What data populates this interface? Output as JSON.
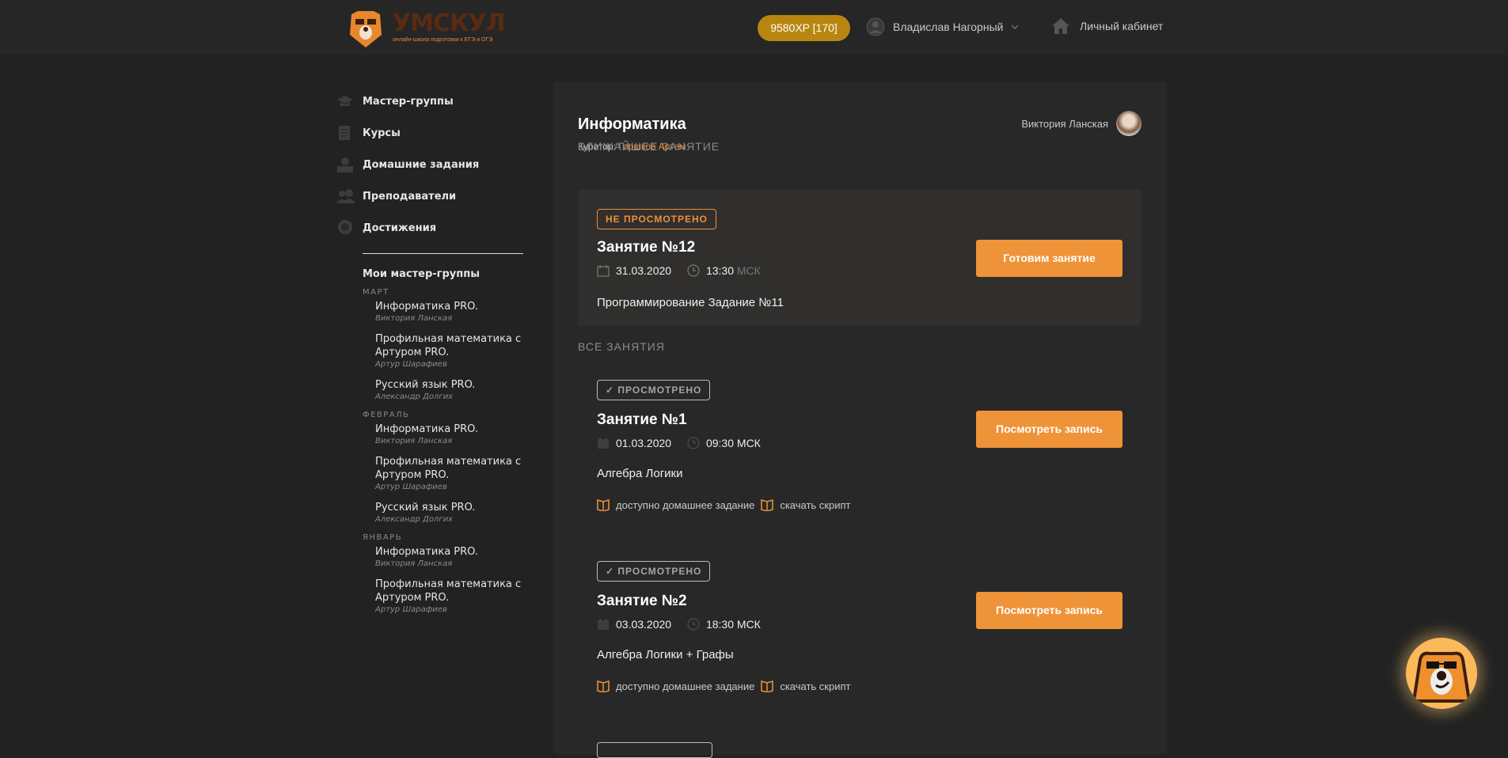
{
  "header": {
    "logo_word": "УМСКУЛ",
    "logo_tagline": "онлайн-школа подготовки к ЕГЭ и ОГЭ",
    "xp": "9580XP [170]",
    "user_name": "Владислав Нагорный",
    "cabinet": "Личный кабинет"
  },
  "sidebar": {
    "nav": [
      {
        "label": "Мастер-группы",
        "icon": "graduation-cap-icon"
      },
      {
        "label": "Курсы",
        "icon": "document-icon"
      },
      {
        "label": "Домашние задания",
        "icon": "books-apple-icon"
      },
      {
        "label": "Преподаватели",
        "icon": "users-icon"
      },
      {
        "label": "Достижения",
        "icon": "medal-icon"
      }
    ],
    "my_groups_title": "Мои мастер-группы",
    "months": [
      {
        "name": "МАРТ",
        "groups": [
          {
            "title": "Информатика PRO.",
            "teacher": "Виктория Ланская"
          },
          {
            "title": "Профильная математика с Артуром PRO.",
            "teacher": "Артур Шарафиев"
          },
          {
            "title": "Русский язык PRO.",
            "teacher": "Александр Долгих"
          }
        ]
      },
      {
        "name": "ФЕВРАЛЬ",
        "groups": [
          {
            "title": "Информатика PRO.",
            "teacher": "Виктория Ланская"
          },
          {
            "title": "Профильная математика с Артуром PRO.",
            "teacher": "Артур Шарафиев"
          },
          {
            "title": "Русский язык PRO.",
            "teacher": "Александр Долгих"
          }
        ]
      },
      {
        "name": "ЯНВАРЬ",
        "groups": [
          {
            "title": "Информатика PRO.",
            "teacher": "Виктория Ланская"
          },
          {
            "title": "Профильная математика с Артуром PRO.",
            "teacher": "Артур Шарафиев"
          }
        ]
      }
    ]
  },
  "main": {
    "title": "Информатика",
    "curator_label": "Куратор:",
    "curator_name": "Горшков Артем",
    "teacher": "Виктория Ланская",
    "next_heading": "БЛИЖАЙШЕЕ ЗАНЯТИЕ",
    "all_heading": "ВСЕ ЗАНЯТИЯ",
    "next": {
      "status": "НЕ ПРОСМОТРЕНО",
      "title": "Занятие №12",
      "date": "31.03.2020",
      "time": "13:30",
      "tz": "МСК",
      "description": "Программирование Задание №11",
      "button": "Готовим занятие"
    },
    "lessons": [
      {
        "status": "ПРОСМОТРЕНО",
        "title": "Занятие №1",
        "date": "01.03.2020",
        "time": "09:30",
        "tz": "МСК",
        "description": "Алгебра Логики",
        "button": "Посмотреть запись",
        "homework": "доступно домашнее задание",
        "script": "скачать скрипт"
      },
      {
        "status": "ПРОСМОТРЕНО",
        "title": "Занятие №2",
        "date": "03.03.2020",
        "time": "18:30",
        "tz": "МСК",
        "description": "Алгебра Логики + Графы",
        "button": "Посмотреть запись",
        "homework": "доступно домашнее задание",
        "script": "скачать скрипт"
      }
    ]
  },
  "colors": {
    "accent": "#ef9338",
    "xp": "#b8860f",
    "background": "#222222",
    "panel": "#282828"
  }
}
